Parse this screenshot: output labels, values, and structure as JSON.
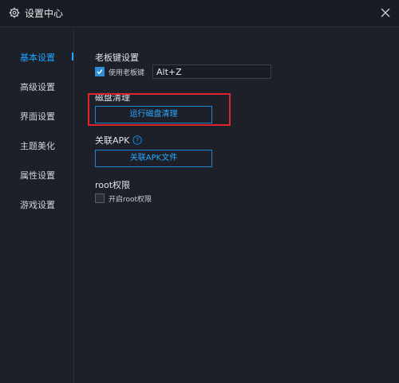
{
  "window": {
    "title": "设置中心"
  },
  "sidebar": {
    "items": [
      {
        "label": "基本设置"
      },
      {
        "label": "高级设置"
      },
      {
        "label": "界面设置"
      },
      {
        "label": "主题美化"
      },
      {
        "label": "属性设置"
      },
      {
        "label": "游戏设置"
      }
    ]
  },
  "boss_key": {
    "title": "老板键设置",
    "checkbox_label": "使用老板键",
    "checked": true,
    "hotkey_value": "Alt+Z"
  },
  "disk_clean": {
    "title": "磁盘清理",
    "button_label": "运行磁盘清理"
  },
  "apk": {
    "title": "关联APK",
    "button_label": "关联APK文件"
  },
  "root": {
    "title": "root权限",
    "checkbox_label": "开启root权限",
    "checked": false
  },
  "colors": {
    "accent": "#1aa5ff",
    "highlight": "#e0242b",
    "background": "#1e2029"
  }
}
